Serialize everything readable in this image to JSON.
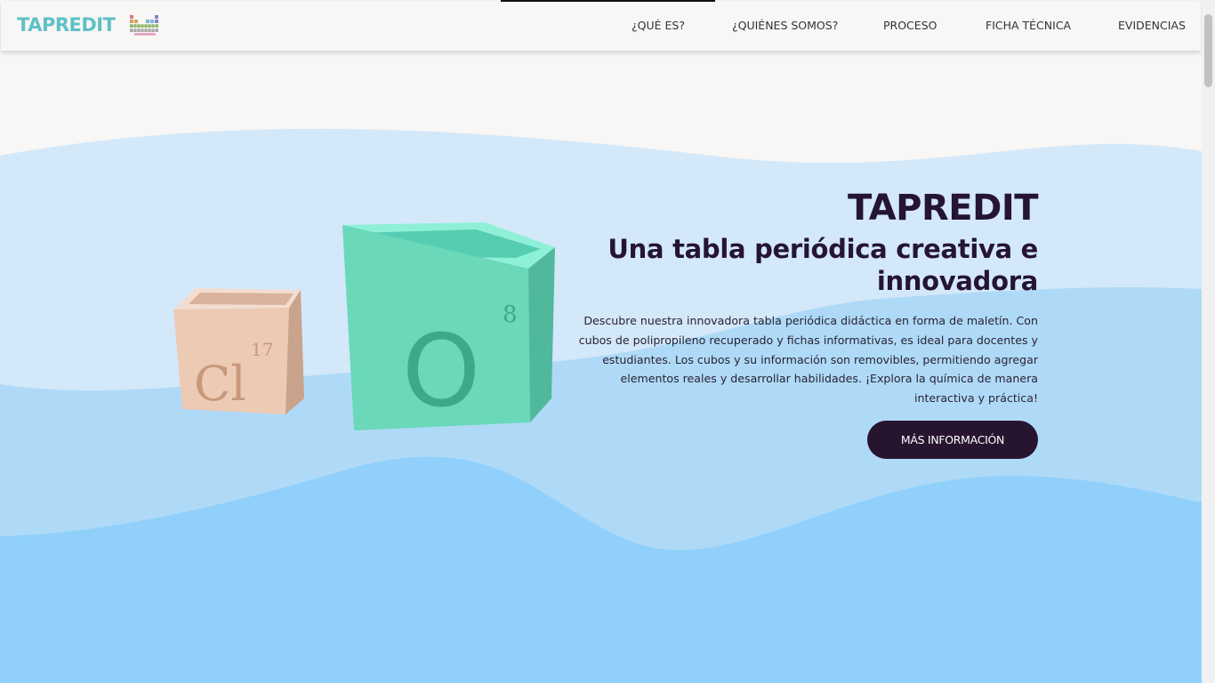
{
  "nav": {
    "brand": "TAPREDIT",
    "logo_icon": "periodic-table-icon",
    "items": [
      {
        "label": "¿QUÉ ES?"
      },
      {
        "label": "¿QUIÉNES SOMOS?"
      },
      {
        "label": "PROCESO"
      },
      {
        "label": "FICHA TÉCNICA"
      },
      {
        "label": "EVIDENCIAS"
      }
    ]
  },
  "hero": {
    "title": "TAPREDIT",
    "subtitle": "Una tabla periódica creativa e innovadora",
    "description": "Descubre nuestra innovadora tabla periódica didáctica en forma de maletín. Con cubos de polipropileno recuperado y fichas informativas, es ideal para docentes y estudiantes. Los cubos y su información son removibles, permitiendo agregar elementos reales y desarrollar habilidades. ¡Explora la química de manera interactiva y práctica!",
    "cta_label": "MÁS INFORMACIÓN",
    "image": {
      "cube_small": {
        "symbol": "Cl",
        "number": "17"
      },
      "cube_large": {
        "symbol": "O",
        "number": "8"
      }
    }
  },
  "colors": {
    "brand": "#5ec1c6",
    "primary_dark": "#251434",
    "wave_light": "#d3e8f9",
    "wave_mid": "#afdaf7",
    "wave_deep": "#90d0fb",
    "cube_small": "#ecc9b3",
    "cube_large": "#6bd9bb"
  }
}
